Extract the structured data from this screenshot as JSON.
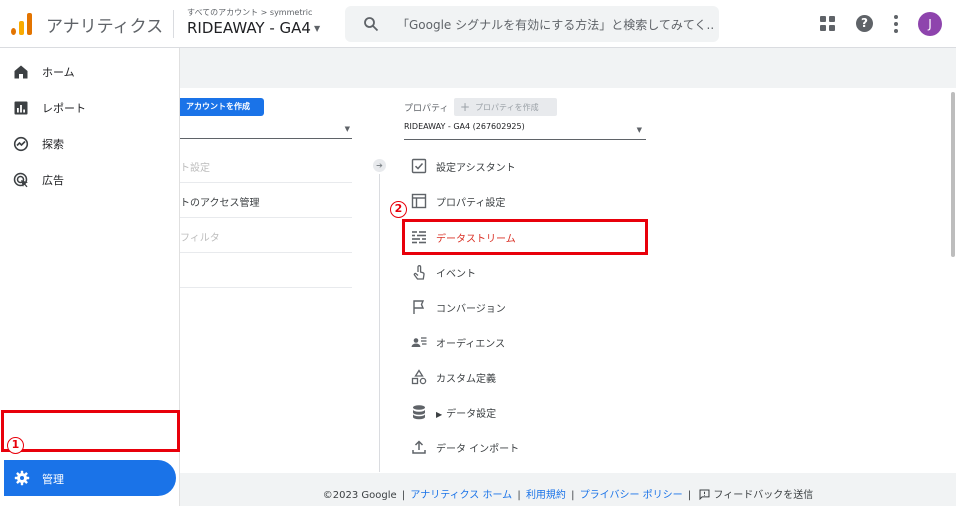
{
  "header": {
    "app_title": "アナリティクス",
    "breadcrumb": "すべてのアカウント > symmetric",
    "property_name": "RIDEAWAY - GA4",
    "search_placeholder": "「Google シグナルを有効にする方法」と検索してみてく...",
    "avatar_letter": "J"
  },
  "nav": {
    "items": [
      {
        "label": "ホーム",
        "icon": "home-icon"
      },
      {
        "label": "レポート",
        "icon": "bar-chart-icon"
      },
      {
        "label": "探索",
        "icon": "explore-icon"
      },
      {
        "label": "広告",
        "icon": "ads-icon"
      }
    ],
    "admin_label": "管理"
  },
  "annotations": {
    "step1": "1",
    "step2": "2"
  },
  "account_column": {
    "create_button": "アカウントを作成",
    "rows": [
      "ト設定",
      "トのアクセス管理",
      "フィルタ"
    ]
  },
  "property_column": {
    "label": "プロパティ",
    "create_button": "プロパティを作成",
    "selected": "RIDEAWAY - GA4 (267602925)",
    "items": [
      {
        "label": "設定アシスタント",
        "icon": "checklist-icon"
      },
      {
        "label": "プロパティ設定",
        "icon": "layout-icon"
      },
      {
        "label": "データストリーム",
        "icon": "data-stream-icon",
        "active": true
      },
      {
        "label": "イベント",
        "icon": "touch-icon"
      },
      {
        "label": "コンバージョン",
        "icon": "flag-icon"
      },
      {
        "label": "オーディエンス",
        "icon": "audience-icon"
      },
      {
        "label": "カスタム定義",
        "icon": "shapes-icon"
      },
      {
        "label": "データ設定",
        "icon": "database-icon"
      },
      {
        "label": "データ インポート",
        "icon": "upload-icon"
      }
    ]
  },
  "footer": {
    "copyright": "©2023 Google",
    "links": [
      "アナリティクス ホーム",
      "利用規約",
      "プライバシー ポリシー"
    ],
    "feedback": "フィードバックを送信"
  },
  "colors": {
    "accent": "#1a73e8",
    "highlight": "#e8000b",
    "active_text": "#d93025"
  }
}
